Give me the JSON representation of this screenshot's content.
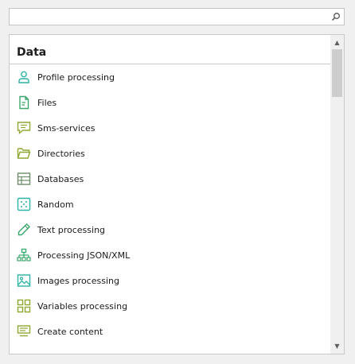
{
  "search": {
    "value": "",
    "placeholder": ""
  },
  "group": {
    "title": "Data"
  },
  "items": [
    {
      "label": "Profile processing",
      "icon": "user-icon"
    },
    {
      "label": "Files",
      "icon": "file-icon"
    },
    {
      "label": "Sms-services",
      "icon": "message-icon"
    },
    {
      "label": "Directories",
      "icon": "folder-icon"
    },
    {
      "label": "Databases",
      "icon": "database-icon"
    },
    {
      "label": "Random",
      "icon": "dice-icon"
    },
    {
      "label": "Text processing",
      "icon": "pencil-icon"
    },
    {
      "label": "Processing JSON/XML",
      "icon": "tree-icon"
    },
    {
      "label": "Images processing",
      "icon": "image-icon"
    },
    {
      "label": "Variables processing",
      "icon": "grid-icon"
    },
    {
      "label": "Create content",
      "icon": "create-content-icon"
    }
  ],
  "colors": {
    "icon_green": "#3aa76d",
    "icon_teal": "#2bb3a6",
    "icon_olive": "#8fa832"
  }
}
